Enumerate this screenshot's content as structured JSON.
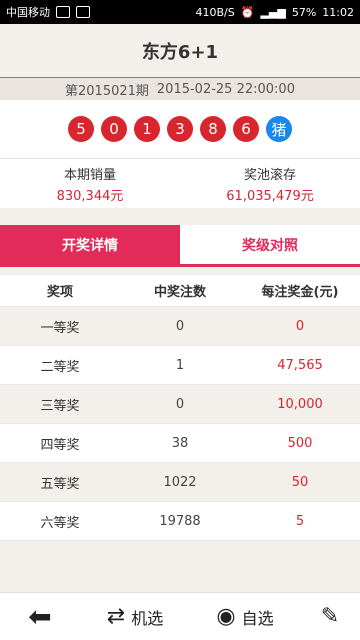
{
  "statusbar": {
    "carrier": "中国移动",
    "speed": "410B/S",
    "battery": "57%",
    "time": "11:02"
  },
  "header": {
    "title": "东方6+1"
  },
  "issue": {
    "period": "第2015021期",
    "datetime": "2015-02-25 22:00:00"
  },
  "balls": {
    "numbers": [
      "5",
      "0",
      "1",
      "3",
      "8",
      "6"
    ],
    "zodiac": "猪"
  },
  "stats": {
    "sales_label": "本期销量",
    "sales_value": "830,344元",
    "pool_label": "奖池滚存",
    "pool_value": "61,035,479元"
  },
  "tabs": {
    "details": "开奖详情",
    "compare": "奖级对照"
  },
  "table": {
    "headers": [
      "奖项",
      "中奖注数",
      "每注奖金(元)"
    ],
    "rows": [
      {
        "prize": "一等奖",
        "count": "0",
        "amount": "0"
      },
      {
        "prize": "二等奖",
        "count": "1",
        "amount": "47,565"
      },
      {
        "prize": "三等奖",
        "count": "0",
        "amount": "10,000"
      },
      {
        "prize": "四等奖",
        "count": "38",
        "amount": "500"
      },
      {
        "prize": "五等奖",
        "count": "1022",
        "amount": "50"
      },
      {
        "prize": "六等奖",
        "count": "19788",
        "amount": "5"
      }
    ]
  },
  "bottombar": {
    "random": "机选",
    "self_select": "自选"
  }
}
